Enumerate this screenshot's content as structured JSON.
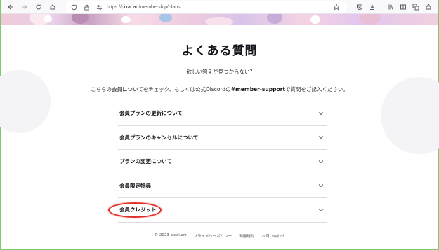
{
  "browser": {
    "url_prefix": "https://",
    "url_host": "pixai.art",
    "url_path": "/membership/plans"
  },
  "faq": {
    "title": "よくある質問",
    "subtitle": "欲しい答えが見つからない?",
    "desc_pre": "こちらの",
    "desc_link": "会員について",
    "desc_mid": "をチェック、もしくは公式Discordの",
    "desc_channel": "#member-support",
    "desc_post": "で質問をご記入ください。",
    "items": [
      {
        "label": "会員プランの更新について"
      },
      {
        "label": "会員プランのキャンセルについて"
      },
      {
        "label": "プランの変更について"
      },
      {
        "label": "会員限定特典"
      },
      {
        "label": "会員クレジット"
      }
    ]
  },
  "footer": {
    "copyright": "© 2023 pixai.art",
    "privacy": "プライバシーポリシー",
    "terms": "利用規約",
    "contact": "お問い合わせ"
  },
  "colors": {
    "highlight": "#e0302a",
    "frame": "#7ec96b"
  }
}
